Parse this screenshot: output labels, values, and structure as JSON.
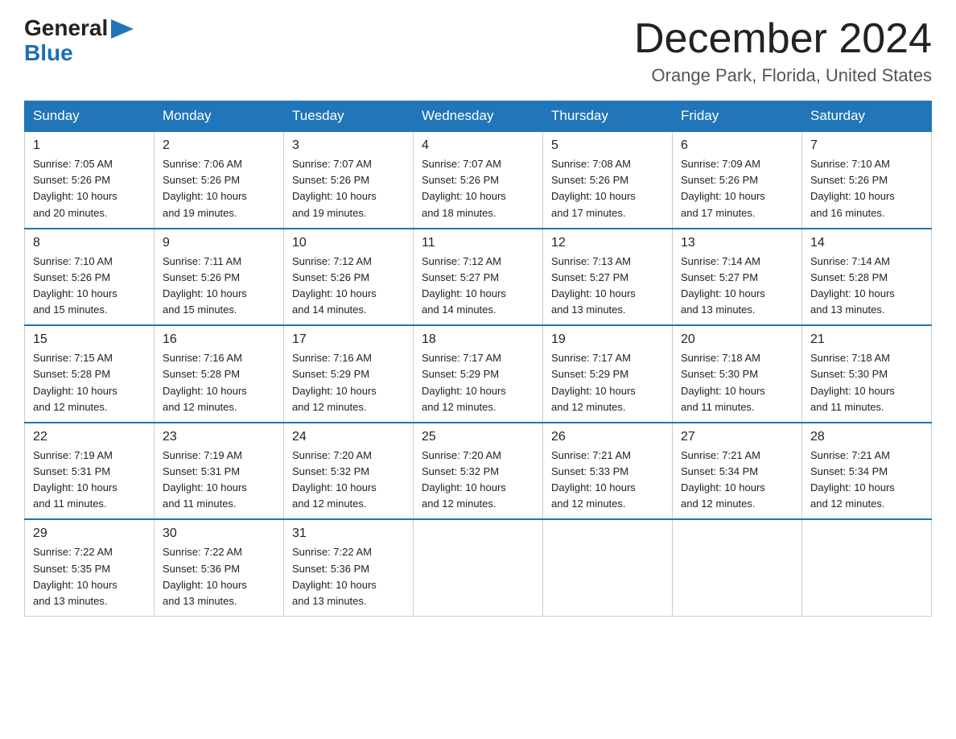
{
  "logo": {
    "general": "General",
    "blue": "Blue"
  },
  "header": {
    "title": "December 2024",
    "location": "Orange Park, Florida, United States"
  },
  "days_of_week": [
    "Sunday",
    "Monday",
    "Tuesday",
    "Wednesday",
    "Thursday",
    "Friday",
    "Saturday"
  ],
  "weeks": [
    [
      {
        "day": "1",
        "sunrise": "7:05 AM",
        "sunset": "5:26 PM",
        "daylight": "10 hours and 20 minutes."
      },
      {
        "day": "2",
        "sunrise": "7:06 AM",
        "sunset": "5:26 PM",
        "daylight": "10 hours and 19 minutes."
      },
      {
        "day": "3",
        "sunrise": "7:07 AM",
        "sunset": "5:26 PM",
        "daylight": "10 hours and 19 minutes."
      },
      {
        "day": "4",
        "sunrise": "7:07 AM",
        "sunset": "5:26 PM",
        "daylight": "10 hours and 18 minutes."
      },
      {
        "day": "5",
        "sunrise": "7:08 AM",
        "sunset": "5:26 PM",
        "daylight": "10 hours and 17 minutes."
      },
      {
        "day": "6",
        "sunrise": "7:09 AM",
        "sunset": "5:26 PM",
        "daylight": "10 hours and 17 minutes."
      },
      {
        "day": "7",
        "sunrise": "7:10 AM",
        "sunset": "5:26 PM",
        "daylight": "10 hours and 16 minutes."
      }
    ],
    [
      {
        "day": "8",
        "sunrise": "7:10 AM",
        "sunset": "5:26 PM",
        "daylight": "10 hours and 15 minutes."
      },
      {
        "day": "9",
        "sunrise": "7:11 AM",
        "sunset": "5:26 PM",
        "daylight": "10 hours and 15 minutes."
      },
      {
        "day": "10",
        "sunrise": "7:12 AM",
        "sunset": "5:26 PM",
        "daylight": "10 hours and 14 minutes."
      },
      {
        "day": "11",
        "sunrise": "7:12 AM",
        "sunset": "5:27 PM",
        "daylight": "10 hours and 14 minutes."
      },
      {
        "day": "12",
        "sunrise": "7:13 AM",
        "sunset": "5:27 PM",
        "daylight": "10 hours and 13 minutes."
      },
      {
        "day": "13",
        "sunrise": "7:14 AM",
        "sunset": "5:27 PM",
        "daylight": "10 hours and 13 minutes."
      },
      {
        "day": "14",
        "sunrise": "7:14 AM",
        "sunset": "5:28 PM",
        "daylight": "10 hours and 13 minutes."
      }
    ],
    [
      {
        "day": "15",
        "sunrise": "7:15 AM",
        "sunset": "5:28 PM",
        "daylight": "10 hours and 12 minutes."
      },
      {
        "day": "16",
        "sunrise": "7:16 AM",
        "sunset": "5:28 PM",
        "daylight": "10 hours and 12 minutes."
      },
      {
        "day": "17",
        "sunrise": "7:16 AM",
        "sunset": "5:29 PM",
        "daylight": "10 hours and 12 minutes."
      },
      {
        "day": "18",
        "sunrise": "7:17 AM",
        "sunset": "5:29 PM",
        "daylight": "10 hours and 12 minutes."
      },
      {
        "day": "19",
        "sunrise": "7:17 AM",
        "sunset": "5:29 PM",
        "daylight": "10 hours and 12 minutes."
      },
      {
        "day": "20",
        "sunrise": "7:18 AM",
        "sunset": "5:30 PM",
        "daylight": "10 hours and 11 minutes."
      },
      {
        "day": "21",
        "sunrise": "7:18 AM",
        "sunset": "5:30 PM",
        "daylight": "10 hours and 11 minutes."
      }
    ],
    [
      {
        "day": "22",
        "sunrise": "7:19 AM",
        "sunset": "5:31 PM",
        "daylight": "10 hours and 11 minutes."
      },
      {
        "day": "23",
        "sunrise": "7:19 AM",
        "sunset": "5:31 PM",
        "daylight": "10 hours and 11 minutes."
      },
      {
        "day": "24",
        "sunrise": "7:20 AM",
        "sunset": "5:32 PM",
        "daylight": "10 hours and 12 minutes."
      },
      {
        "day": "25",
        "sunrise": "7:20 AM",
        "sunset": "5:32 PM",
        "daylight": "10 hours and 12 minutes."
      },
      {
        "day": "26",
        "sunrise": "7:21 AM",
        "sunset": "5:33 PM",
        "daylight": "10 hours and 12 minutes."
      },
      {
        "day": "27",
        "sunrise": "7:21 AM",
        "sunset": "5:34 PM",
        "daylight": "10 hours and 12 minutes."
      },
      {
        "day": "28",
        "sunrise": "7:21 AM",
        "sunset": "5:34 PM",
        "daylight": "10 hours and 12 minutes."
      }
    ],
    [
      {
        "day": "29",
        "sunrise": "7:22 AM",
        "sunset": "5:35 PM",
        "daylight": "10 hours and 13 minutes."
      },
      {
        "day": "30",
        "sunrise": "7:22 AM",
        "sunset": "5:36 PM",
        "daylight": "10 hours and 13 minutes."
      },
      {
        "day": "31",
        "sunrise": "7:22 AM",
        "sunset": "5:36 PM",
        "daylight": "10 hours and 13 minutes."
      },
      null,
      null,
      null,
      null
    ]
  ],
  "labels": {
    "sunrise": "Sunrise:",
    "sunset": "Sunset:",
    "daylight": "Daylight:"
  }
}
